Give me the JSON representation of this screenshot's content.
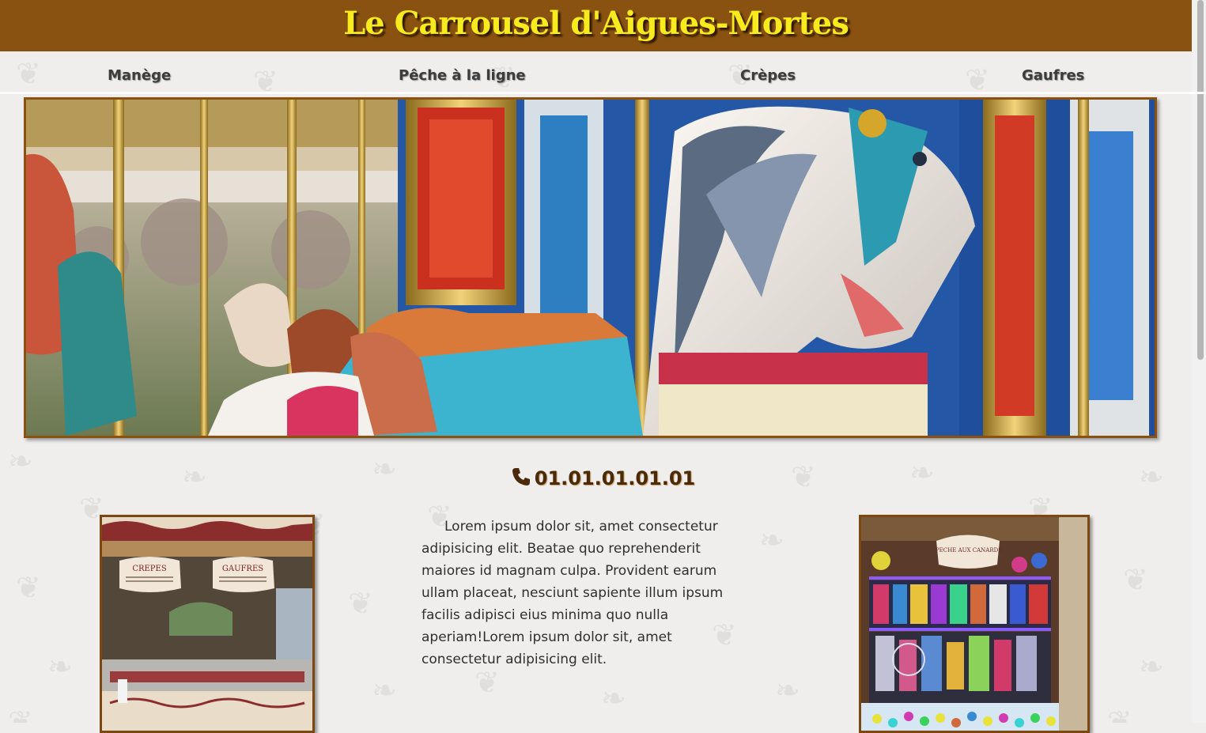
{
  "header": {
    "title": "Le Carrousel d'Aigues-Mortes"
  },
  "nav": {
    "items": [
      {
        "label": "Manège"
      },
      {
        "label": "Pêche à la ligne"
      },
      {
        "label": "Crèpes"
      },
      {
        "label": "Gaufres"
      }
    ]
  },
  "hero": {
    "image": "carousel-horses-photo"
  },
  "contact": {
    "icon": "phone-icon",
    "phone": "01.01.01.01.01"
  },
  "main": {
    "paragraph": "Lorem ipsum dolor sit, amet consectetur adipisicing elit. Beatae quo reprehenderit maiores id magnam culpa. Provident earum ullam placeat, nesciunt sapiente illum ipsum facilis adipisci eius minima quo nulla aperiam!Lorem ipsum dolor sit, amet consectetur adipisicing elit.",
    "left_photo": {
      "image": "crepes-gaufres-stand-photo",
      "sign_crepes": "CREPES",
      "sign_gaufres": "GAUFRES"
    },
    "right_photo": {
      "image": "fishing-game-stall-photo",
      "sign": "PECHE AUX CANARDS"
    }
  },
  "colors": {
    "header_bg": "#8a5210",
    "title": "#f7eb1e",
    "frame": "#8a5210",
    "background": "#efeeed"
  }
}
